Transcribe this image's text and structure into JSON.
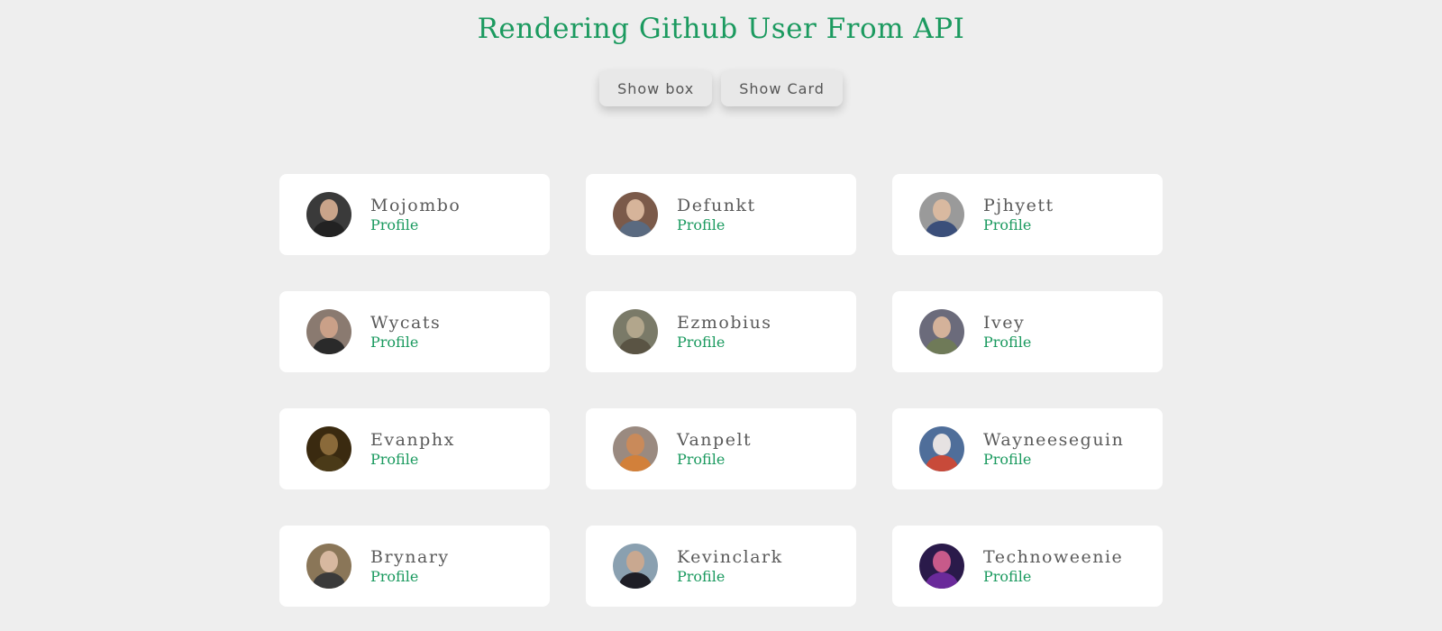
{
  "header": {
    "title": "Rendering Github User From API"
  },
  "toolbar": {
    "show_box_label": "Show box",
    "show_card_label": "Show Card"
  },
  "users": [
    {
      "name": "Mojombo",
      "link": "Profile",
      "bg": "#3a3a3a",
      "skin": "#c9a48a",
      "shirt": "#222222"
    },
    {
      "name": "Defunkt",
      "link": "Profile",
      "bg": "#7b5a4a",
      "skin": "#d6b49a",
      "shirt": "#5a6a80"
    },
    {
      "name": "Pjhyett",
      "link": "Profile",
      "bg": "#9a9a9a",
      "skin": "#d9b9a0",
      "shirt": "#3b4f7a"
    },
    {
      "name": "Wycats",
      "link": "Profile",
      "bg": "#8a7a70",
      "skin": "#caa088",
      "shirt": "#2a2a2a"
    },
    {
      "name": "Ezmobius",
      "link": "Profile",
      "bg": "#7a7a68",
      "skin": "#b2a68c",
      "shirt": "#5a5444"
    },
    {
      "name": "Ivey",
      "link": "Profile",
      "bg": "#6b6b7b",
      "skin": "#d4b29a",
      "shirt": "#6f7a58"
    },
    {
      "name": "Evanphx",
      "link": "Profile",
      "bg": "#3a2a10",
      "skin": "#8a6a3a",
      "shirt": "#4a3a18"
    },
    {
      "name": "Vanpelt",
      "link": "Profile",
      "bg": "#9a8a80",
      "skin": "#c98a5a",
      "shirt": "#d2803a"
    },
    {
      "name": "Wayneeseguin",
      "link": "Profile",
      "bg": "#4f6e9a",
      "skin": "#e6e2e2",
      "shirt": "#c84a3a"
    },
    {
      "name": "Brynary",
      "link": "Profile",
      "bg": "#8a7658",
      "skin": "#d7b8a0",
      "shirt": "#3a3a3a"
    },
    {
      "name": "Kevinclark",
      "link": "Profile",
      "bg": "#8aa0b0",
      "skin": "#c9a890",
      "shirt": "#1e1e26"
    },
    {
      "name": "Technoweenie",
      "link": "Profile",
      "bg": "#2a1a4a",
      "skin": "#c75a8a",
      "shirt": "#6a2a9a"
    }
  ]
}
